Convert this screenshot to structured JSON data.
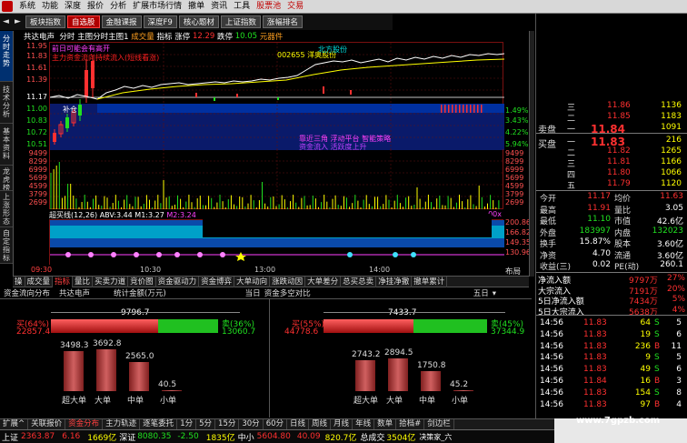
{
  "menu": {
    "items": [
      "系统",
      "功能",
      "深度",
      "报价",
      "分析",
      "扩展市场行情",
      "撤单",
      "资讯",
      "工具",
      "股票池",
      "交易"
    ]
  },
  "toolbar": {
    "buttons": [
      "板块指数",
      "自选股",
      "金融课报",
      "深度F9",
      "核心题材",
      "上证指数",
      "涨幅排名"
    ],
    "active": 1
  },
  "sidetabs": [
    "分时走势",
    "技术分析",
    "基本资料",
    "龙虎榜",
    "上涨形态",
    "自定指标"
  ],
  "chart": {
    "header": {
      "stock": "共达电声",
      "mode": "分时",
      "main": "主图",
      "main2": "分时主图1",
      "vol": "成交量",
      "idx": "指标",
      "change_label": "涨停",
      "limit_up": "12.29",
      "limit_down_label": "跌停",
      "limit_down": "10.05",
      "chip_label": "元器件"
    },
    "price_axis": [
      "11.95",
      "11.83",
      "11.61",
      "11.39",
      "11.17",
      "11.00",
      "10.83",
      "10.72",
      "10.51"
    ],
    "pct_axis": [
      "7.07%",
      "5.10%",
      "3.06%",
      "1.94%",
      "1.06%",
      "1.49%",
      "3.43%",
      "4.22%",
      "5.94%"
    ],
    "vol_axis": [
      "9499",
      "8299",
      "6999",
      "5699",
      "4599",
      "3799",
      "2699",
      "1799"
    ],
    "ind_axis": [
      "200.86",
      "166.82",
      "149.35",
      "130.96"
    ],
    "ann": {
      "a1": "前日可能会有高开",
      "a2": "主力资金流向持续流入(短线看涨)",
      "a3": "002655 洋奥股份",
      "a4": "北方股份",
      "a5": "补仓",
      "a6": "靠近三角 浮动平台 智能策略",
      "a7": "资金流入 活跃度上升"
    },
    "indicator": {
      "name": "超买线(12,26)",
      "abv_label": "ABV:",
      "abv": "3.44",
      "m1_label": "M1:",
      "m1": "3.27",
      "m2_label": "M2:",
      "m2": "3.24",
      "right": "00x"
    },
    "time_axis": [
      "09:30",
      "10:30",
      "13:00",
      "14:00"
    ],
    "layout_btn": "布局"
  },
  "quote": {
    "ask_label": "卖盘",
    "bid_label": "买盘",
    "asks": [
      {
        "lv": "三",
        "p": "11.86",
        "v": "1136"
      },
      {
        "lv": "二",
        "p": "11.85",
        "v": "1183"
      },
      {
        "lv": "一",
        "p": "11.84",
        "v": "1091"
      }
    ],
    "bids": [
      {
        "lv": "一",
        "p": "11.83",
        "v": "216"
      },
      {
        "lv": "二",
        "p": "11.82",
        "v": "1265"
      },
      {
        "lv": "三",
        "p": "11.81",
        "v": "1166"
      },
      {
        "lv": "四",
        "p": "11.80",
        "v": "1066"
      },
      {
        "lv": "五",
        "p": "11.79",
        "v": "1120"
      }
    ],
    "stats": [
      {
        "l1": "今开",
        "v1": "11.17",
        "l2": "均价",
        "v2": "11.63"
      },
      {
        "l1": "最高",
        "v1": "11.91",
        "l2": "量比",
        "v2": "3.05"
      },
      {
        "l1": "最低",
        "v1": "11.10",
        "l2": "市值",
        "v2": "42.6亿"
      },
      {
        "l1": "外盘",
        "v1": "183997",
        "l2": "内盘",
        "v2": "132023"
      },
      {
        "l1": "换手",
        "v1": "15.87%",
        "l2": "股本",
        "v2": "3.60亿"
      },
      {
        "l1": "净资",
        "v1": "4.70",
        "l2": "流通",
        "v2": "3.60亿"
      },
      {
        "l1": "收益(三)",
        "v1": "0.02",
        "l2": "PE(动)",
        "v2": "260.1"
      }
    ],
    "flows": [
      {
        "l": "净流入额",
        "v": "9797万",
        "p": "27%"
      },
      {
        "l": "大宗流入",
        "v": "7191万",
        "p": "20%"
      },
      {
        "l": "5日净流入额",
        "v": "7434万",
        "p": "5%"
      },
      {
        "l": "5日大宗流入",
        "v": "5638万",
        "p": "4%"
      }
    ],
    "ticks": [
      {
        "t": "14:56",
        "p": "11.83",
        "v": "64",
        "s": "S",
        "n": "5"
      },
      {
        "t": "14:56",
        "p": "11.83",
        "v": "19",
        "s": "S",
        "n": "6"
      },
      {
        "t": "14:56",
        "p": "11.83",
        "v": "236",
        "s": "B",
        "n": "11"
      },
      {
        "t": "14:56",
        "p": "11.83",
        "v": "9",
        "s": "S",
        "n": "5"
      },
      {
        "t": "14:56",
        "p": "11.83",
        "v": "49",
        "s": "S",
        "n": "6"
      },
      {
        "t": "14:56",
        "p": "11.84",
        "v": "16",
        "s": "B",
        "n": "3"
      },
      {
        "t": "14:56",
        "p": "11.83",
        "v": "154",
        "s": "S",
        "n": "8"
      },
      {
        "t": "14:56",
        "p": "11.83",
        "v": "97",
        "s": "B",
        "n": "4"
      }
    ]
  },
  "tabs": [
    "成交量",
    "指标",
    "量比",
    "买卖力道",
    "竞价图",
    "资金驱动力",
    "资金博弈",
    "大单动向",
    "涨跌动因",
    "大单差分",
    "总买总卖",
    "净挂净撤",
    "撤单累计"
  ],
  "tabs_active": 1,
  "flow_panel": {
    "title1": "资金流向分布",
    "stock": "共达电声",
    "unit": "统计金额(万元)",
    "today": "当日",
    "title2": "资金多空对比",
    "range": "五日",
    "left": {
      "total": "9796.7",
      "buy_label": "买(64%)",
      "buy_val": "22857.4",
      "sell_label": "卖(36%)",
      "sell_val": "13060.7",
      "buy_pct": 64,
      "bars": [
        {
          "v": "3498.3",
          "n": "超大单",
          "h": 3498.3
        },
        {
          "v": "3692.8",
          "n": "大单",
          "h": 3692.8
        },
        {
          "v": "2565.0",
          "n": "中单",
          "h": 2565.0
        },
        {
          "v": "40.5",
          "n": "小单",
          "h": 40.5
        }
      ]
    },
    "right": {
      "total": "7433.7",
      "buy_label": "买(55%)",
      "buy_val": "44778.6",
      "sell_label": "卖(45%)",
      "sell_val": "37344.9",
      "buy_pct": 55,
      "bars": [
        {
          "v": "2743.2",
          "n": "超大单",
          "h": 2743.2
        },
        {
          "v": "2894.5",
          "n": "大单",
          "h": 2894.5
        },
        {
          "v": "1750.8",
          "n": "中单",
          "h": 1750.8
        },
        {
          "v": "45.2",
          "n": "小单",
          "h": 45.2
        }
      ]
    }
  },
  "bottom_tabs": [
    "扩展^",
    "关联报价",
    "资金分布",
    "主力轨迹",
    "逐笔委托",
    "1分",
    "5分",
    "15分",
    "30分",
    "60分",
    "日线",
    "周线",
    "月线",
    "年线",
    "数单",
    "拾档#",
    "剑边栏"
  ],
  "bottom_tabs_active": 2,
  "status": {
    "sh_label": "上证",
    "sh_val": "2363.87",
    "sh_chg": "6.16",
    "sh_amt": "1669亿",
    "sz_label": "深证",
    "sz_val": "8080.35",
    "sz_chg": "-2.50",
    "sz_amt": "1835亿",
    "zx_label": "中小",
    "zx_val": "5604.80",
    "zx_chg": "40.09",
    "zx_amt": "820.7亿",
    "tot_label": "总成交",
    "tot_val": "3504亿",
    "user": "决策家_六"
  },
  "watermark": "www.7gpzb.com"
}
